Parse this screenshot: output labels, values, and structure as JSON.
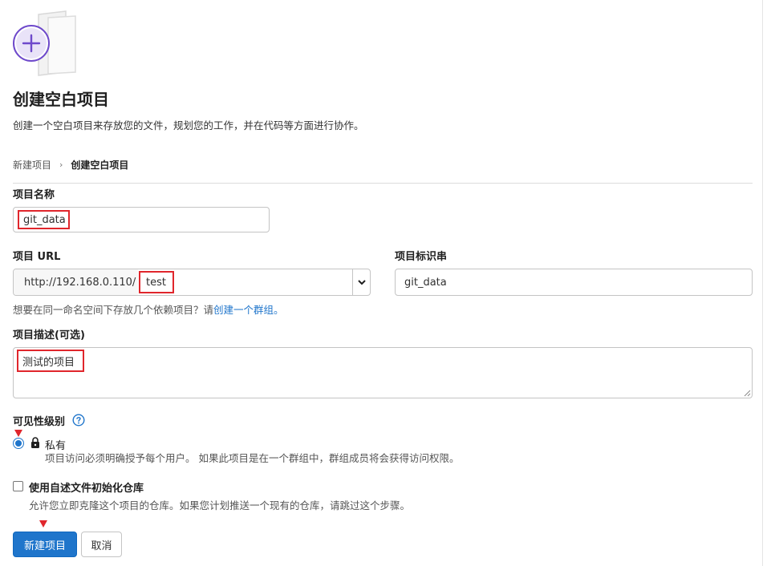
{
  "illustration": {
    "icon": "plus-circle-icon",
    "accent": "#6e49cb"
  },
  "header": {
    "title": "创建空白项目",
    "description": "创建一个空白项目来存放您的文件，规划您的工作，并在代码等方面进行协作。"
  },
  "breadcrumb": {
    "parent": "新建项目",
    "separator": "›",
    "current": "创建空白项目"
  },
  "form": {
    "project_name": {
      "label": "项目名称",
      "value": "git_data"
    },
    "project_url": {
      "label": "项目 URL",
      "prefix": "http://192.168.0.110/",
      "namespace": "test"
    },
    "project_slug": {
      "label": "项目标识串",
      "value": "git_data"
    },
    "hint": {
      "text": "想要在同一命名空间下存放几个依赖项目？请",
      "link": "创建一个群组。"
    },
    "description": {
      "label": "项目描述(可选)",
      "value": "测试的项目"
    },
    "visibility": {
      "label": "可见性级别",
      "help_icon": "question-circle-icon",
      "option_label": "私有",
      "option_help": "项目访问必须明确授予每个用户。 如果此项目是在一个群组中，群组成员将会获得访问权限。",
      "selected": true
    },
    "readme": {
      "label": "使用自述文件初始化仓库",
      "help": "允许您立即克隆这个项目的仓库。如果您计划推送一个现有的仓库，请跳过这个步骤。",
      "checked": false
    }
  },
  "actions": {
    "create": "新建项目",
    "cancel": "取消"
  },
  "colors": {
    "primary": "#1f75cb",
    "highlight": "#e0262c"
  }
}
